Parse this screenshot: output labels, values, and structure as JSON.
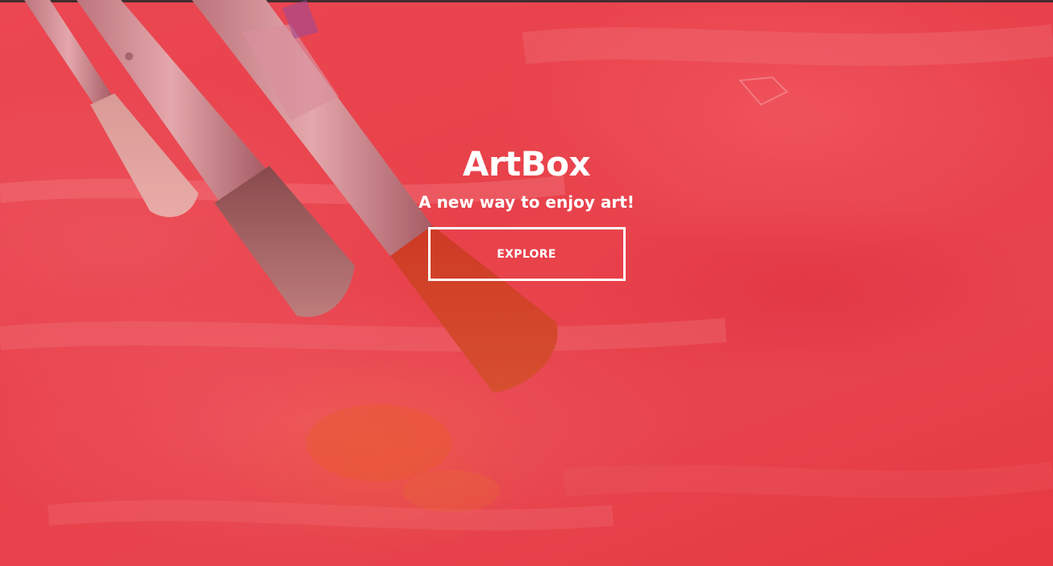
{
  "hero": {
    "title": "ArtBox",
    "subtitle": "A new way to enjoy art!",
    "explore_label": "EXPLORE",
    "background_color": "#e8404a",
    "accent_color": "#ffffff"
  },
  "imagery": {
    "subject": "paint-brushes-image"
  }
}
